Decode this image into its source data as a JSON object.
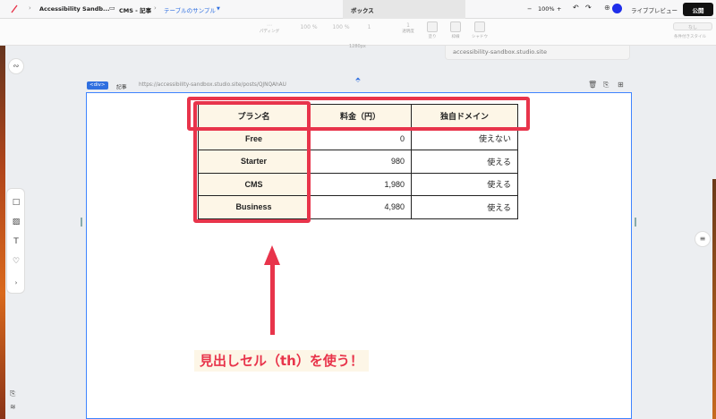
{
  "topbar": {
    "project": "Accessibility Sandb...",
    "page": "CMS - 記事",
    "component": "テーブルのサンプル",
    "active_tab": "ボックス",
    "zoom_minus": "−",
    "zoom_value": "100%",
    "zoom_plus": "+",
    "live_preview": "ライブプレビュー",
    "publish": "公開"
  },
  "propbar": {
    "padding_label": "パディング",
    "w_value": "100",
    "w_unit": "%",
    "h_value": "100",
    "h_unit": "%",
    "one_value": "1",
    "opacity_value": "1",
    "opacity_label": "透明度",
    "fill_label": "塗り",
    "border_label": "枠線",
    "shadow_label": "シャドウ",
    "style_none": "なし",
    "style_label": "条件付きスタイル",
    "width_readout": "1280px"
  },
  "site_url": "accessibility-sandbox.studio.site",
  "canvas": {
    "badge": "<div>",
    "record_title": "記事",
    "record_url": "https://accessibility-sandbox.studio.site/posts/QJNQAhAU"
  },
  "table": {
    "headers": [
      "プラン名",
      "料金（円）",
      "独自ドメイン"
    ],
    "rows": [
      {
        "plan": "Free",
        "price": "0",
        "domain": "使えない"
      },
      {
        "plan": "Starter",
        "price": "980",
        "domain": "使える"
      },
      {
        "plan": "CMS",
        "price": "1,980",
        "domain": "使える"
      },
      {
        "plan": "Business",
        "price": "4,980",
        "domain": "使える"
      }
    ]
  },
  "annotation": {
    "text": "見出しセル（th）を使う！",
    "color": "#e8344b"
  },
  "colors": {
    "accent_blue": "#2f6fe0",
    "header_cell_bg": "#fdf6e7",
    "publish_bg": "#111111"
  },
  "icons": {
    "logo": "studio-slash-icon",
    "page": "page-icon",
    "undo": "undo-icon",
    "redo": "redo-icon",
    "trash": "trash-icon",
    "copy": "copy-icon",
    "add": "add-page-icon"
  }
}
